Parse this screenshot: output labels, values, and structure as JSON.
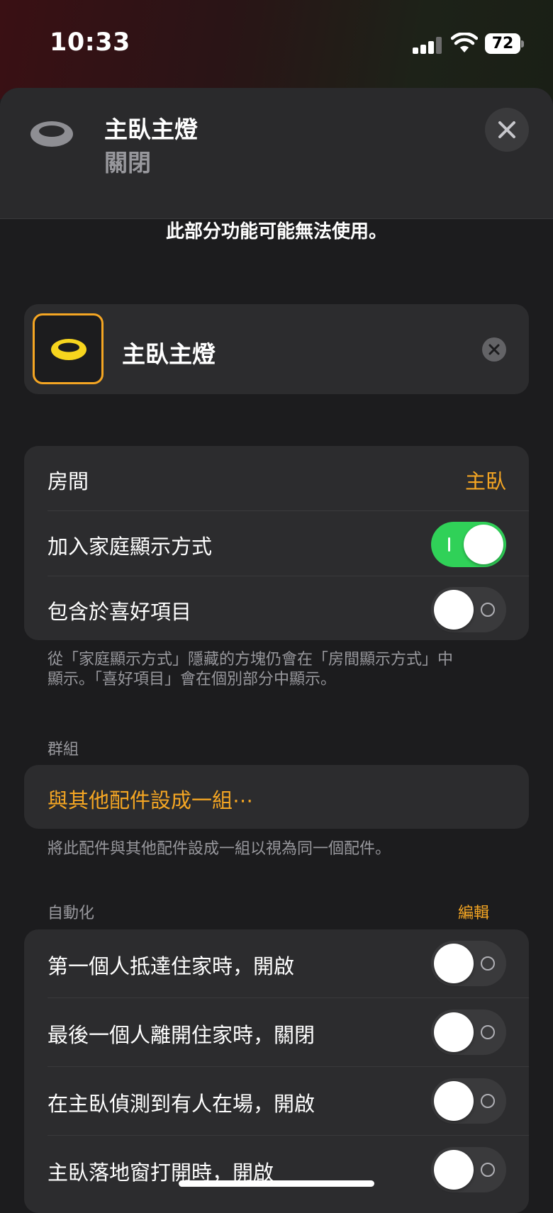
{
  "status": {
    "time": "10:33",
    "battery": "72"
  },
  "header": {
    "title": "主臥主燈",
    "subtitle": "關閉"
  },
  "notice": "此部分功能可能無法使用。",
  "accessory": {
    "name": "主臥主燈"
  },
  "settings": {
    "room_label": "房間",
    "room_value": "主臥",
    "home_view_label": "加入家庭顯示方式",
    "home_view_on": true,
    "favorites_label": "包含於喜好項目",
    "favorites_on": false,
    "footnote_line1": "從「家庭顯示方式」隱藏的方塊仍會在「房間顯示方式」中",
    "footnote_line2": "顯示。「喜好項目」會在個別部分中顯示。"
  },
  "group": {
    "section_label": "群組",
    "link": "與其他配件設成一組⋯",
    "footnote": "將此配件與其他配件設成一組以視為同一個配件。"
  },
  "automation": {
    "section_label": "自動化",
    "edit_label": "編輯",
    "items": [
      {
        "label": "第一個人抵達住家時，開啟",
        "on": false
      },
      {
        "label": "最後一個人離開住家時，關閉",
        "on": false
      },
      {
        "label": "在主臥偵測到有人在場，開啟",
        "on": false
      },
      {
        "label": "主臥落地窗打開時，開啟",
        "on": false
      }
    ]
  },
  "colors": {
    "accent": "#f5a623",
    "toggle_on": "#30d158",
    "background": "#1c1c1e",
    "card": "#2c2c2e"
  }
}
